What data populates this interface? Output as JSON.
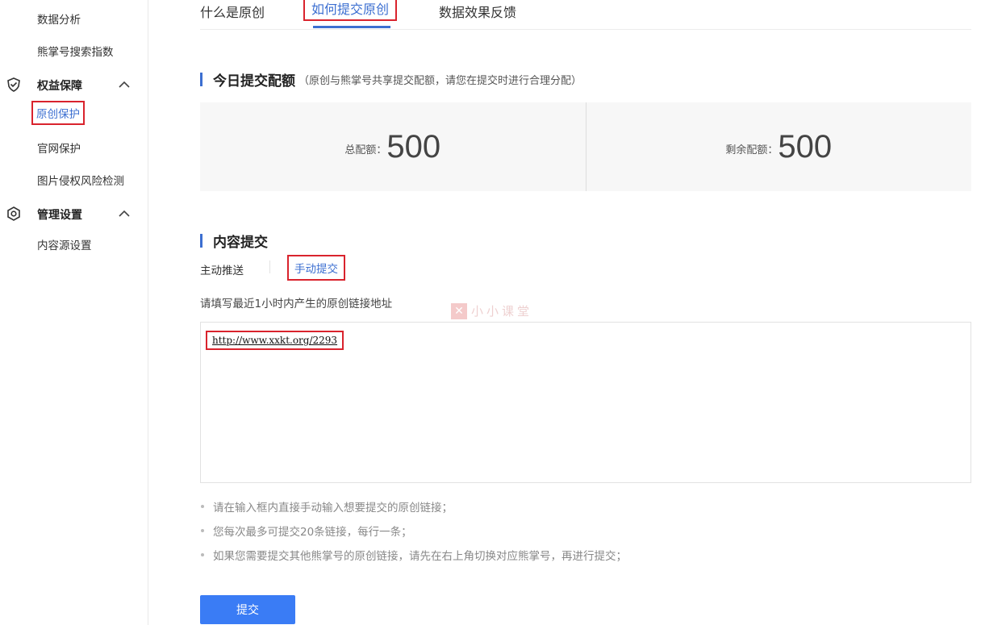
{
  "sidebar": {
    "items_top": [
      "数据分析",
      "熊掌号搜索指数"
    ],
    "group_rights": {
      "label": "权益保障",
      "items": [
        "原创保护",
        "官网保护",
        "图片侵权风险检测"
      ]
    },
    "group_manage": {
      "label": "管理设置",
      "items": [
        "内容源设置"
      ]
    }
  },
  "tabs": [
    "什么是原创",
    "如何提交原创",
    "数据效果反馈"
  ],
  "quota": {
    "title": "今日提交配额",
    "note": "（原创与熊掌号共享提交配额，请您在提交时进行合理分配）",
    "total_label": "总配额：",
    "total_value": "500",
    "remaining_label": "剩余配额：",
    "remaining_value": "500"
  },
  "content_submit": {
    "title": "内容提交",
    "modes": [
      "主动推送",
      "手动提交"
    ],
    "hint": "请填写最近1小时内产生的原创链接地址",
    "url_value": "http://www.xxkt.org/2293",
    "notes": [
      "请在输入框内直接手动输入想要提交的原创链接；",
      "您每次最多可提交20条链接，每行一条；",
      "如果您需要提交其他熊掌号的原创链接，请先在右上角切换对应熊掌号，再进行提交；"
    ],
    "submit_label": "提交"
  },
  "watermark": {
    "text": "小小课堂"
  },
  "colors": {
    "accent": "#3c6fd1",
    "highlight": "#d9232d",
    "button": "#3a7cf5"
  }
}
